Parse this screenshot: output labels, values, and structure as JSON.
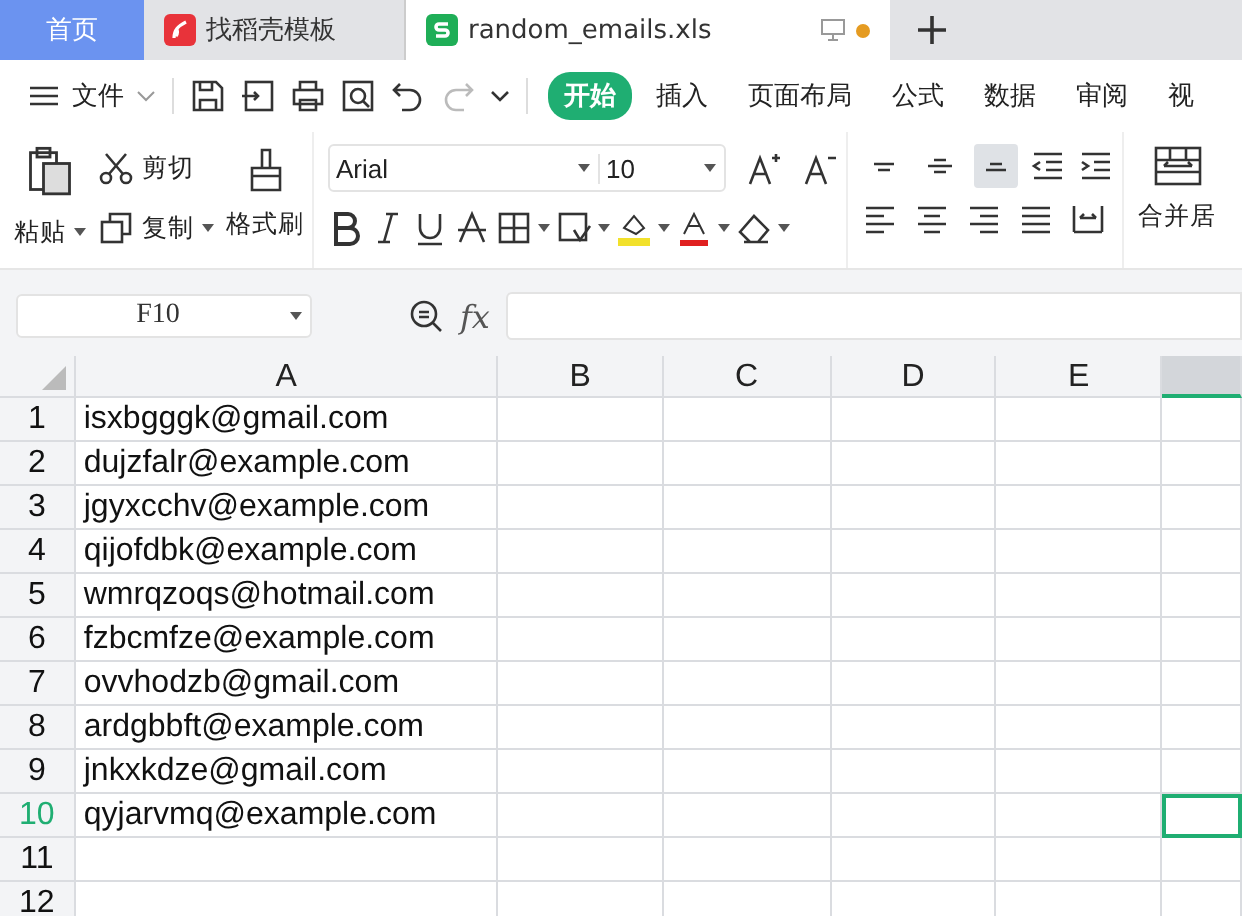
{
  "tabs": [
    {
      "kind": "home",
      "label": "首页",
      "selected": false
    },
    {
      "kind": "template",
      "label": "找稻壳模板",
      "selected": false
    },
    {
      "kind": "sheet",
      "label": "random_emails.xls",
      "selected": true,
      "unsaved": true
    }
  ],
  "menu": {
    "file_label": "文件",
    "items": [
      {
        "label": "开始",
        "selected": true
      },
      {
        "label": "插入",
        "selected": false
      },
      {
        "label": "页面布局",
        "selected": false
      },
      {
        "label": "公式",
        "selected": false
      },
      {
        "label": "数据",
        "selected": false
      },
      {
        "label": "审阅",
        "selected": false
      },
      {
        "label": "视",
        "selected": false
      }
    ]
  },
  "ribbon": {
    "paste": "粘贴",
    "cut": "剪切",
    "copy": "复制",
    "format_painter": "格式刷",
    "font": "Arial",
    "font_size": "10",
    "align_buttons": [
      {
        "kind": "top",
        "selected": false
      },
      {
        "kind": "middle",
        "selected": false
      },
      {
        "kind": "bottom",
        "selected": true
      }
    ],
    "merge": "合并居"
  },
  "formula_bar": {
    "name_box": "F10",
    "fx": "fx"
  },
  "sheet": {
    "columns": [
      {
        "label": "A",
        "selected": false
      },
      {
        "label": "B",
        "selected": false
      },
      {
        "label": "C",
        "selected": false
      },
      {
        "label": "D",
        "selected": false
      },
      {
        "label": "E",
        "selected": false
      },
      {
        "selected": true
      }
    ],
    "rows": [
      {
        "number": "1",
        "selected": false,
        "cells": [
          "isxbgggk@gmail.com"
        ]
      },
      {
        "number": "2",
        "selected": false,
        "cells": [
          "dujzfalr@example.com"
        ]
      },
      {
        "number": "3",
        "selected": false,
        "cells": [
          "jgyxcchv@example.com"
        ]
      },
      {
        "number": "4",
        "selected": false,
        "cells": [
          "qijofdbk@example.com"
        ]
      },
      {
        "number": "5",
        "selected": false,
        "cells": [
          "wmrqzoqs@hotmail.com"
        ]
      },
      {
        "number": "6",
        "selected": false,
        "cells": [
          "fzbcmfze@example.com"
        ]
      },
      {
        "number": "7",
        "selected": false,
        "cells": [
          "ovvhodzb@gmail.com"
        ]
      },
      {
        "number": "8",
        "selected": false,
        "cells": [
          "ardgbbft@example.com"
        ]
      },
      {
        "number": "9",
        "selected": false,
        "cells": [
          "jnkxkdze@gmail.com"
        ]
      },
      {
        "number": "10",
        "selected": true,
        "cells": [
          "qyjarvmq@example.com"
        ]
      },
      {
        "number": "11",
        "selected": false,
        "cells": []
      },
      {
        "number": "12",
        "selected": false,
        "cells": []
      }
    ]
  }
}
